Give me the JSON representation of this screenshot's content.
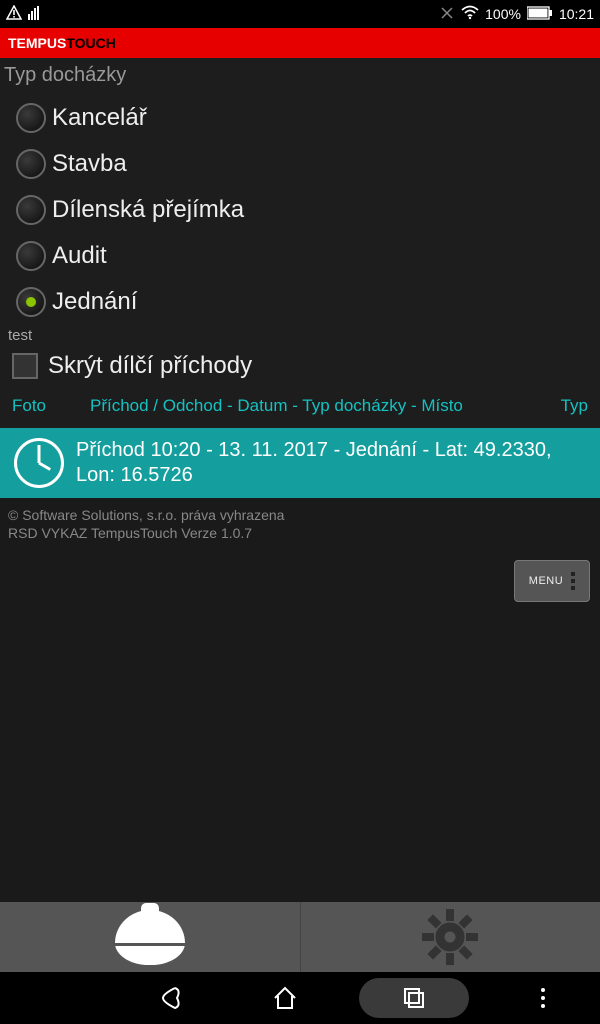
{
  "status": {
    "battery": "100%",
    "time": "10:21"
  },
  "header": {
    "brand1": "TEMPUS",
    "brand2": "TOUCH"
  },
  "section_label": "Typ docházky",
  "radios": [
    {
      "label": "Kancelář",
      "selected": false
    },
    {
      "label": "Stavba",
      "selected": false
    },
    {
      "label": "Dílenská přejímka",
      "selected": false
    },
    {
      "label": "Audit",
      "selected": false
    },
    {
      "label": "Jednání",
      "selected": true
    }
  ],
  "small_label": "test",
  "checkbox_label": "Skrýt dílčí příchody",
  "table_header": {
    "foto": "Foto",
    "main": "Příchod / Odchod - Datum - Typ docházky - Místo",
    "typ": "Typ"
  },
  "entry": {
    "text": "Příchod 10:20 - 13. 11. 2017 - Jednání - Lat: 49.2330, Lon: 16.5726"
  },
  "footer": {
    "copyright": "© Software Solutions, s.r.o. práva vyhrazena",
    "version": "RSD VYKAZ TempusTouch Verze 1.0.7"
  },
  "menu_label": "MENU"
}
